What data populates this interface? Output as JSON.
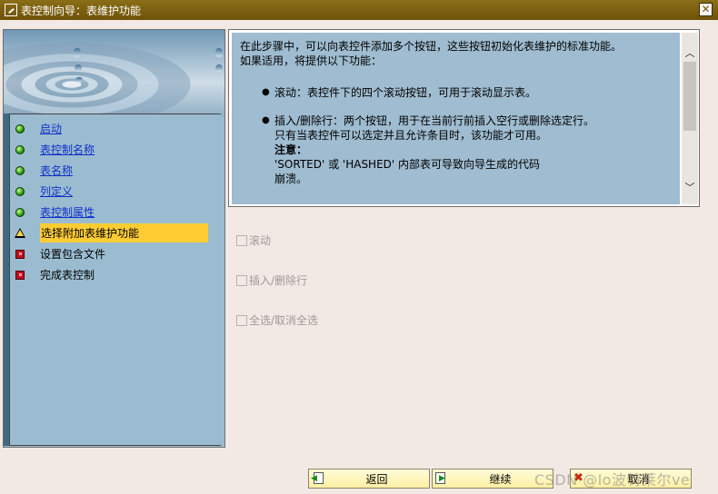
{
  "window": {
    "title": "表控制向导：表维护功能",
    "close_label": "✕"
  },
  "nav": {
    "items": [
      {
        "label": "启动",
        "status": "done"
      },
      {
        "label": "表控制名称",
        "status": "done"
      },
      {
        "label": "表名称",
        "status": "done"
      },
      {
        "label": "列定义",
        "status": "done"
      },
      {
        "label": "表控制属性",
        "status": "done"
      },
      {
        "label": "选择附加表维护功能",
        "status": "current"
      },
      {
        "label": "设置包含文件",
        "status": "todo"
      },
      {
        "label": "完成表控制",
        "status": "todo"
      }
    ]
  },
  "info": {
    "intro_line1": "在此步骤中，可以向表控件添加多个按钮，这些按钮初始化表维护的标准功能。",
    "intro_line2": "如果适用，将提供以下功能：",
    "bullet1": "滚动：表控件下的四个滚动按钮，可用于滚动显示表。",
    "bullet2_line1": "插入/删除行：两个按钮，用于在当前行前插入空行或删除选定行。",
    "bullet2_line2": "只有当表控件可以选定并且允许条目时，该功能才可用。",
    "note_label": "注意：",
    "note_line1": "'SORTED' 或 'HASHED' 内部表可导致向导生成的代码",
    "note_line2": "崩溃。"
  },
  "options": {
    "scroll": {
      "label": "滚动",
      "checked": false,
      "enabled": false
    },
    "insert_delete": {
      "label": "插入/删除行",
      "checked": false,
      "enabled": false
    },
    "select_all": {
      "label": "全选/取消全选",
      "checked": false,
      "enabled": false
    }
  },
  "buttons": {
    "back": "返回",
    "continue": "继续",
    "cancel": "取消"
  },
  "watermark": "CSDN @lo波特莱尔ve",
  "colors": {
    "titlebar": "#7a5d10",
    "panel_blue": "#9fbcd0",
    "highlight": "#ffcc33",
    "button_bg": "#fff3b0",
    "link": "#1030c8"
  }
}
